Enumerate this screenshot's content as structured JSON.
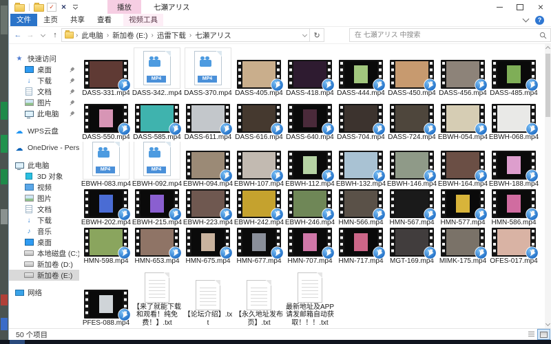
{
  "window": {
    "title": "七瀬アリス",
    "controls": [
      "minimize",
      "maximize",
      "close"
    ]
  },
  "qat": {
    "icons": [
      "folder",
      "separator",
      "folder",
      "check",
      "close",
      "customize"
    ]
  },
  "contextual": {
    "group_label": "播放",
    "tool_tab_label": "视频工具"
  },
  "ribbon": {
    "tabs": [
      {
        "label": "文件",
        "accent": true
      },
      {
        "label": "主页"
      },
      {
        "label": "共享"
      },
      {
        "label": "查看"
      }
    ],
    "right_icons": [
      "collapse-ribbon-icon",
      "help-icon"
    ]
  },
  "address": {
    "nav_icons": [
      "back-icon",
      "forward-icon",
      "recent-chevron-icon",
      "up-icon"
    ]
  },
  "breadcrumb": {
    "separator": "›",
    "crumbs": [
      "此电脑",
      "新加卷 (E:)",
      "迅雷下载",
      "七瀬アリス"
    ]
  },
  "search": {
    "placeholder": "在 七瀬アリス 中搜索"
  },
  "sidebar": {
    "rows": [
      {
        "label": "快速访问",
        "icon": "star",
        "indent": 0
      },
      {
        "label": "桌面",
        "icon": "desktop",
        "indent": 1,
        "pinned": true
      },
      {
        "label": "下载",
        "icon": "download",
        "indent": 1,
        "pinned": true
      },
      {
        "label": "文档",
        "icon": "document",
        "indent": 1,
        "pinned": true
      },
      {
        "label": "图片",
        "icon": "pictures",
        "indent": 1,
        "pinned": true
      },
      {
        "label": "此电脑",
        "icon": "pc",
        "indent": 1,
        "pinned": true
      },
      {
        "label": "WPS云盘",
        "icon": "cloud",
        "indent": 0,
        "gap": true
      },
      {
        "label": "OneDrive - Persona",
        "icon": "onedrive",
        "indent": 0,
        "gap": true
      },
      {
        "label": "此电脑",
        "icon": "pc",
        "indent": 0,
        "gap": true
      },
      {
        "label": "3D 对象",
        "icon": "cube",
        "indent": 1
      },
      {
        "label": "视频",
        "icon": "video",
        "indent": 1
      },
      {
        "label": "图片",
        "icon": "pictures",
        "indent": 1
      },
      {
        "label": "文档",
        "icon": "document",
        "indent": 1
      },
      {
        "label": "下载",
        "icon": "download",
        "indent": 1
      },
      {
        "label": "音乐",
        "icon": "music",
        "indent": 1
      },
      {
        "label": "桌面",
        "icon": "desktop",
        "indent": 1
      },
      {
        "label": "本地磁盘 (C:)",
        "icon": "disk",
        "indent": 1
      },
      {
        "label": "新加卷 (D:)",
        "icon": "disk",
        "indent": 1
      },
      {
        "label": "新加卷 (E:)",
        "icon": "disk",
        "indent": 1,
        "selected": true
      },
      {
        "label": "网络",
        "icon": "network",
        "indent": 0,
        "gap": true
      }
    ]
  },
  "icons": {
    "mp4_badge": "MP4"
  },
  "files": [
    {
      "name": "DASS-331.mp4",
      "kind": "film",
      "style": "full",
      "color": "#5f3a34"
    },
    {
      "name": "DASS-342..mp4",
      "kind": "mp4"
    },
    {
      "name": "DASS-370.mp4",
      "kind": "mp4"
    },
    {
      "name": "DASS-405.mp4",
      "kind": "film",
      "style": "full",
      "color": "#c9ae8c"
    },
    {
      "name": "DASS-418.mp4",
      "kind": "film",
      "style": "full",
      "color": "#2e1b30"
    },
    {
      "name": "DASS-444.mp4",
      "kind": "film",
      "style": "poster",
      "color": "#a2c77e"
    },
    {
      "name": "DASS-450.mp4",
      "kind": "film",
      "style": "full",
      "color": "#c79a6f"
    },
    {
      "name": "DASS-456.mp4",
      "kind": "film",
      "style": "full",
      "color": "#8d8379"
    },
    {
      "name": "DASS-485.mp4",
      "kind": "film",
      "style": "poster",
      "color": "#7fae57"
    },
    {
      "name": "DASS-550.mp4",
      "kind": "film",
      "style": "poster",
      "color": "#d795b5"
    },
    {
      "name": "DASS-585.mp4",
      "kind": "film",
      "style": "full",
      "color": "#3fb3ae"
    },
    {
      "name": "DASS-611.mp4",
      "kind": "film",
      "style": "full",
      "color": "#c3c7cb"
    },
    {
      "name": "DASS-616.mp4",
      "kind": "film",
      "style": "full",
      "color": "#45392f"
    },
    {
      "name": "DASS-640.mp4",
      "kind": "film",
      "style": "poster",
      "color": "#4a2a3a"
    },
    {
      "name": "DASS-704.mp4",
      "kind": "film",
      "style": "full",
      "color": "#3c332e"
    },
    {
      "name": "DASS-724.mp4",
      "kind": "film",
      "style": "full",
      "color": "#4e463c"
    },
    {
      "name": "EBWH-054.mp4",
      "kind": "film",
      "style": "full",
      "color": "#d6cdb4"
    },
    {
      "name": "EBWH-068.mp4",
      "kind": "film",
      "style": "full",
      "color": "#e9e9e7"
    },
    {
      "name": "EBWH-083.mp4",
      "kind": "mp4"
    },
    {
      "name": "EBWH-092.mp4",
      "kind": "mp4"
    },
    {
      "name": "EBWH-094.mp4",
      "kind": "film",
      "style": "full",
      "color": "#9b8a76"
    },
    {
      "name": "EBWH-107.mp4",
      "kind": "film",
      "style": "full",
      "color": "#c2bab1"
    },
    {
      "name": "EBWH-112.mp4",
      "kind": "film",
      "style": "poster",
      "color": "#b6d3a4"
    },
    {
      "name": "EBWH-132.mp4",
      "kind": "film",
      "style": "full",
      "color": "#a9c2d3"
    },
    {
      "name": "EBWH-146.mp4",
      "kind": "film",
      "style": "full",
      "color": "#8f9a88"
    },
    {
      "name": "EBWH-164.mp4",
      "kind": "film",
      "style": "full",
      "color": "#6b4f45"
    },
    {
      "name": "EBWH-188.mp4",
      "kind": "film",
      "style": "poster",
      "color": "#dd9ecd"
    },
    {
      "name": "EBWH-202.mp4",
      "kind": "film",
      "style": "poster",
      "color": "#4a6cd4"
    },
    {
      "name": "EBWH-215.mp4",
      "kind": "film",
      "style": "poster",
      "color": "#8a5fd0"
    },
    {
      "name": "EBWH-223.mp4",
      "kind": "film",
      "style": "full",
      "color": "#6f5850"
    },
    {
      "name": "EBWH-242.mp4",
      "kind": "film",
      "style": "full",
      "color": "#c5a22e"
    },
    {
      "name": "EBWH-246.mp4",
      "kind": "film",
      "style": "full",
      "color": "#6f8757"
    },
    {
      "name": "HMN-566.mp4",
      "kind": "film",
      "style": "full",
      "color": "#5a5148"
    },
    {
      "name": "HMN-567.mp4",
      "kind": "film",
      "style": "full",
      "color": "#1a1a1a"
    },
    {
      "name": "HMN-577.mp4",
      "kind": "film",
      "style": "poster",
      "color": "#d8b43a"
    },
    {
      "name": "HMN-586.mp4",
      "kind": "film",
      "style": "poster",
      "color": "#d06ca0"
    },
    {
      "name": "HMN-598.mp4",
      "kind": "film",
      "style": "full",
      "color": "#8aa55e"
    },
    {
      "name": "HMN-653.mp4",
      "kind": "film",
      "style": "full",
      "color": "#8f7466"
    },
    {
      "name": "HMN-675.mp4",
      "kind": "film",
      "style": "poster",
      "color": "#c9b39e"
    },
    {
      "name": "HMN-677.mp4",
      "kind": "film",
      "style": "poster",
      "color": "#8a8f9a"
    },
    {
      "name": "HMN-707.mp4",
      "kind": "film",
      "style": "poster",
      "color": "#d077a8"
    },
    {
      "name": "HMN-717.mp4",
      "kind": "film",
      "style": "poster",
      "color": "#cc6688"
    },
    {
      "name": "MGT-169.mp4",
      "kind": "film",
      "style": "full",
      "color": "#413d3d"
    },
    {
      "name": "MIMK-175.mp4",
      "kind": "film",
      "style": "full",
      "color": "#7a7268"
    },
    {
      "name": "OFES-017.mp4",
      "kind": "film",
      "style": "full",
      "color": "#d9b3a4"
    },
    {
      "name": "PFES-088.mp4",
      "kind": "film",
      "style": "poster",
      "color": "#cfd4d8"
    },
    {
      "name": "【来了就能下载和观看！纯免费！】.txt",
      "kind": "txt"
    },
    {
      "name": "【论坛介绍】.txt",
      "kind": "txt"
    },
    {
      "name": "【永久地址发布页】.txt",
      "kind": "txt"
    },
    {
      "name": "最新地址及APP请发邮箱自动获取！！！.txt",
      "kind": "txt"
    }
  ],
  "status": {
    "items_text": "50 个项目",
    "view_icons": [
      "details-view-icon",
      "thumbnails-view-icon"
    ]
  }
}
